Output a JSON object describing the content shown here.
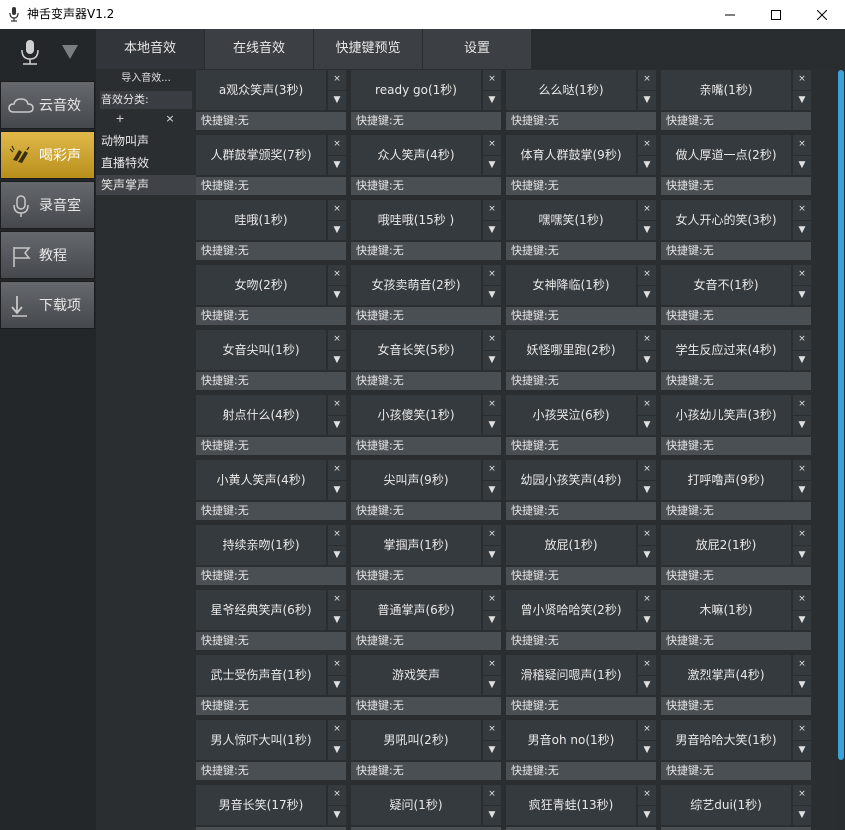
{
  "window": {
    "title": "神舌变声器V1.2",
    "min_symbol": "—",
    "max_symbol": "☐",
    "close_symbol": "✕"
  },
  "sidebar": {
    "icons": [
      "mic-logo-icon",
      "dropdown-triangle-icon"
    ],
    "items": [
      {
        "label": "云音效",
        "icon": "cloud-icon",
        "active": false
      },
      {
        "label": "喝彩声",
        "icon": "clap-icon",
        "active": true
      },
      {
        "label": "录音室",
        "icon": "microphone-icon",
        "active": false
      },
      {
        "label": "教程",
        "icon": "flag-icon",
        "active": false
      },
      {
        "label": "下载项",
        "icon": "download-icon",
        "active": false
      }
    ]
  },
  "tabs": [
    {
      "label": "本地音效",
      "active": true
    },
    {
      "label": "在线音效",
      "active": false
    },
    {
      "label": "快捷键预览",
      "active": false
    },
    {
      "label": "设置",
      "active": false
    }
  ],
  "categories": {
    "import_label": "导入音效...",
    "title": "音效分类:",
    "add_label": "+",
    "remove_label": "×",
    "items": [
      {
        "label": "动物叫声",
        "active": false
      },
      {
        "label": "直播特效",
        "active": false
      },
      {
        "label": "笑声掌声",
        "active": true
      }
    ]
  },
  "card_controls": {
    "delete_symbol": "×",
    "dropdown_symbol": "▼"
  },
  "sounds": [
    {
      "name": "a观众笑声(3秒)",
      "hotkey": "快捷键:无"
    },
    {
      "name": "ready go(1秒)",
      "hotkey": "快捷键:无"
    },
    {
      "name": "么么哒(1秒)",
      "hotkey": "快捷键:无"
    },
    {
      "name": "亲嘴(1秒)",
      "hotkey": "快捷键:无"
    },
    {
      "name": "人群鼓掌颁奖(7秒)",
      "hotkey": "快捷键:无"
    },
    {
      "name": "众人笑声(4秒)",
      "hotkey": "快捷键:无"
    },
    {
      "name": "体育人群鼓掌(9秒)",
      "hotkey": "快捷键:无"
    },
    {
      "name": "做人厚道一点(2秒)",
      "hotkey": "快捷键:无"
    },
    {
      "name": "哇哦(1秒)",
      "hotkey": "快捷键:无"
    },
    {
      "name": "哦哇哦(15秒 )",
      "hotkey": "快捷键:无"
    },
    {
      "name": "嘿嘿笑(1秒)",
      "hotkey": "快捷键:无"
    },
    {
      "name": "女人开心的笑(3秒)",
      "hotkey": "快捷键:无"
    },
    {
      "name": "女吻(2秒)",
      "hotkey": "快捷键:无"
    },
    {
      "name": "女孩卖萌音(2秒)",
      "hotkey": "快捷键:无"
    },
    {
      "name": "女神降临(1秒)",
      "hotkey": "快捷键:无"
    },
    {
      "name": "女音不(1秒)",
      "hotkey": "快捷键:无"
    },
    {
      "name": "女音尖叫(1秒)",
      "hotkey": "快捷键:无"
    },
    {
      "name": "女音长笑(5秒)",
      "hotkey": "快捷键:无"
    },
    {
      "name": "妖怪哪里跑(2秒)",
      "hotkey": "快捷键:无"
    },
    {
      "name": "学生反应过来(4秒)",
      "hotkey": "快捷键:无"
    },
    {
      "name": "射点什么(4秒)",
      "hotkey": "快捷键:无"
    },
    {
      "name": "小孩傻笑(1秒)",
      "hotkey": "快捷键:无"
    },
    {
      "name": "小孩哭泣(6秒)",
      "hotkey": "快捷键:无"
    },
    {
      "name": "小孩幼儿笑声(3秒)",
      "hotkey": "快捷键:无"
    },
    {
      "name": "小黄人笑声(4秒)",
      "hotkey": "快捷键:无"
    },
    {
      "name": "尖叫声(9秒)",
      "hotkey": "快捷键:无"
    },
    {
      "name": "幼园小孩笑声(4秒)",
      "hotkey": "快捷键:无"
    },
    {
      "name": "打呼噜声(9秒)",
      "hotkey": "快捷键:无"
    },
    {
      "name": "持续亲吻(1秒)",
      "hotkey": "快捷键:无"
    },
    {
      "name": "掌掴声(1秒)",
      "hotkey": "快捷键:无"
    },
    {
      "name": "放屁(1秒)",
      "hotkey": "快捷键:无"
    },
    {
      "name": "放屁2(1秒)",
      "hotkey": "快捷键:无"
    },
    {
      "name": "星爷经典笑声(6秒)",
      "hotkey": "快捷键:无"
    },
    {
      "name": "普通掌声(6秒)",
      "hotkey": "快捷键:无"
    },
    {
      "name": "曾小贤哈哈笑(2秒)",
      "hotkey": "快捷键:无"
    },
    {
      "name": "木嘛(1秒)",
      "hotkey": "快捷键:无"
    },
    {
      "name": "武士受伤声音(1秒)",
      "hotkey": "快捷键:无"
    },
    {
      "name": "游戏笑声",
      "hotkey": "快捷键:无"
    },
    {
      "name": "滑稽疑问嗯声(1秒)",
      "hotkey": "快捷键:无"
    },
    {
      "name": "激烈掌声(4秒)",
      "hotkey": "快捷键:无"
    },
    {
      "name": "男人惊吓大叫(1秒)",
      "hotkey": "快捷键:无"
    },
    {
      "name": "男吼叫(2秒)",
      "hotkey": "快捷键:无"
    },
    {
      "name": "男音oh no(1秒)",
      "hotkey": "快捷键:无"
    },
    {
      "name": "男音哈哈大笑(1秒)",
      "hotkey": "快捷键:无"
    },
    {
      "name": "男音长笑(17秒)",
      "hotkey": ""
    },
    {
      "name": "疑问(1秒)",
      "hotkey": ""
    },
    {
      "name": "疯狂青蛙(13秒)",
      "hotkey": ""
    },
    {
      "name": "综艺dui(1秒)",
      "hotkey": ""
    }
  ],
  "colors": {
    "accent_active": "#d4a52c",
    "scrollbar": "#3aa3d8",
    "background": "#2b2e31"
  }
}
